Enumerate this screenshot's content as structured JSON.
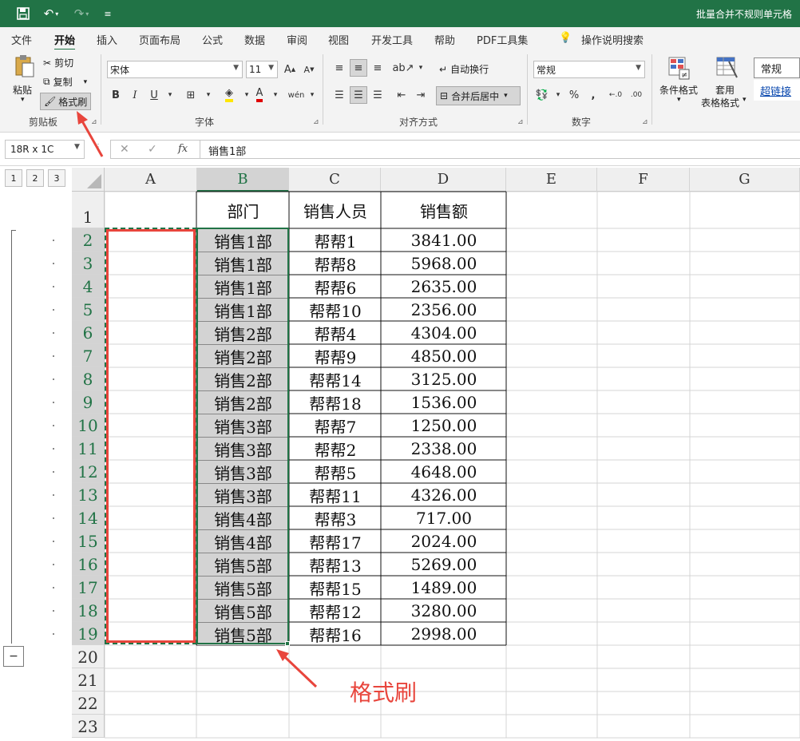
{
  "title_bar": {
    "title": "批量合并不规则单元格",
    "qa_icons": [
      "save-icon",
      "undo-icon",
      "redo-icon",
      "customize-icon"
    ],
    "accent": "#217346"
  },
  "tabs": [
    "文件",
    "开始",
    "插入",
    "页面布局",
    "公式",
    "数据",
    "审阅",
    "视图",
    "开发工具",
    "帮助",
    "PDF工具集",
    "操作说明搜索"
  ],
  "active_tab": "开始",
  "ribbon": {
    "clipboard": {
      "paste": "粘贴",
      "cut": "剪切",
      "copy": "复制",
      "format_painter": "格式刷",
      "label": "剪贴板"
    },
    "font": {
      "name": "宋体",
      "size": "11",
      "bold": "B",
      "italic": "I",
      "underline": "U",
      "label": "字体"
    },
    "align": {
      "wrap": "自动换行",
      "merge": "合并后居中",
      "label": "对齐方式"
    },
    "number": {
      "format": "常规",
      "percent": "%",
      "comma": ",",
      "inc_dec": ".00",
      "label": "数字"
    },
    "styles": {
      "cond_format": "条件格式",
      "table_format_1": "套用",
      "table_format_2": "表格格式",
      "style_normal": "常规",
      "style_link": "超链接"
    }
  },
  "formula_bar": {
    "name_box": "18R x 1C",
    "content": "销售1部",
    "fx": "fx",
    "cancel": "✕",
    "enter": "✓"
  },
  "outline": {
    "levels": [
      "1",
      "2",
      "3"
    ],
    "collapse": "−"
  },
  "columns": [
    "A",
    "B",
    "C",
    "D",
    "E",
    "F",
    "G"
  ],
  "selected_column": "B",
  "rows": [
    "1",
    "2",
    "3",
    "4",
    "5",
    "6",
    "7",
    "8",
    "9",
    "10",
    "11",
    "12",
    "13",
    "14",
    "15",
    "16",
    "17",
    "18",
    "19",
    "20",
    "21",
    "22",
    "23"
  ],
  "table": {
    "headers": [
      "部门",
      "销售人员",
      "销售额"
    ],
    "rows": [
      [
        "销售1部",
        "帮帮1",
        "3841.00"
      ],
      [
        "销售1部",
        "帮帮8",
        "5968.00"
      ],
      [
        "销售1部",
        "帮帮6",
        "2635.00"
      ],
      [
        "销售1部",
        "帮帮10",
        "2356.00"
      ],
      [
        "销售2部",
        "帮帮4",
        "4304.00"
      ],
      [
        "销售2部",
        "帮帮9",
        "4850.00"
      ],
      [
        "销售2部",
        "帮帮14",
        "3125.00"
      ],
      [
        "销售2部",
        "帮帮18",
        "1536.00"
      ],
      [
        "销售3部",
        "帮帮7",
        "1250.00"
      ],
      [
        "销售3部",
        "帮帮2",
        "2338.00"
      ],
      [
        "销售3部",
        "帮帮5",
        "4648.00"
      ],
      [
        "销售3部",
        "帮帮11",
        "4326.00"
      ],
      [
        "销售4部",
        "帮帮3",
        "717.00"
      ],
      [
        "销售4部",
        "帮帮17",
        "2024.00"
      ],
      [
        "销售5部",
        "帮帮13",
        "5269.00"
      ],
      [
        "销售5部",
        "帮帮15",
        "1489.00"
      ],
      [
        "销售5部",
        "帮帮12",
        "3280.00"
      ],
      [
        "销售5部",
        "帮帮16",
        "2998.00"
      ]
    ]
  },
  "annotation": {
    "text": "格式刷",
    "color": "#e8453c"
  }
}
